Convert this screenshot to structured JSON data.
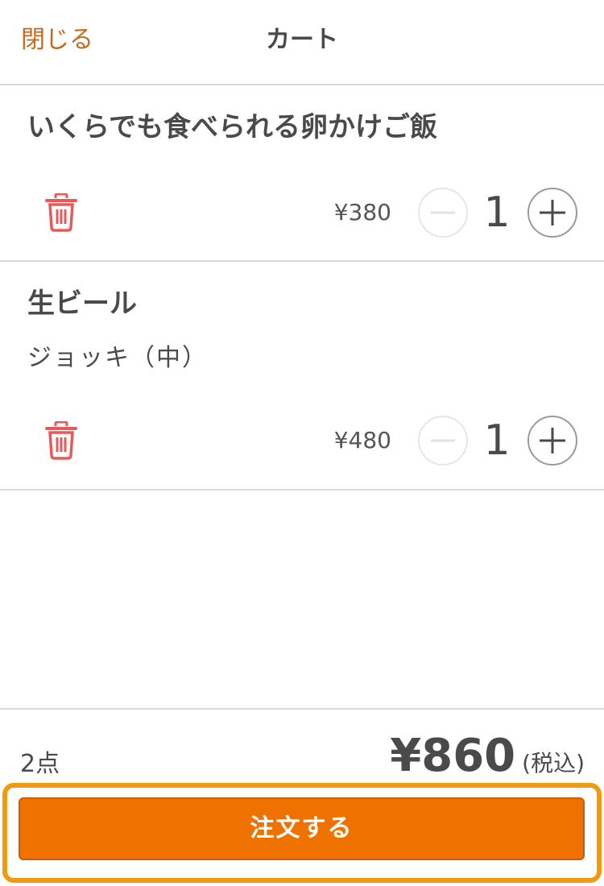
{
  "header": {
    "close_label": "閉じる",
    "title": "カート"
  },
  "items": [
    {
      "name": "いくらでも食べられる卵かけご飯",
      "option": "",
      "price": "¥380",
      "quantity": "1"
    },
    {
      "name": "生ビール",
      "option": "ジョッキ（中）",
      "price": "¥480",
      "quantity": "1"
    }
  ],
  "footer": {
    "count": "2点",
    "total": "¥860",
    "tax_note": "(税込)",
    "order_label": "注文する"
  },
  "colors": {
    "accent": "#ef7200",
    "close_link": "#c8681a",
    "trash": "#e85a5a",
    "focus_ring": "#f29a0f"
  },
  "icons": {
    "trash": "trash-icon",
    "minus": "minus-icon",
    "plus": "plus-icon"
  }
}
